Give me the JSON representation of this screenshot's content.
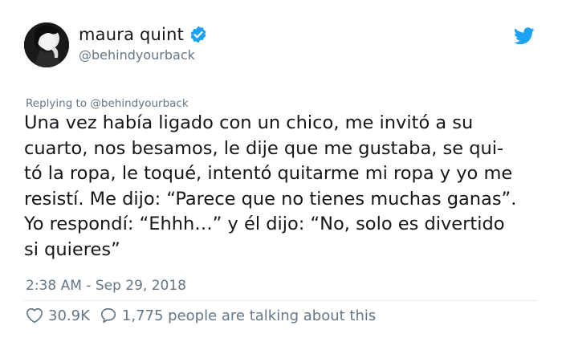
{
  "tweet": {
    "author": {
      "display_name": "maura quint",
      "handle": "@behindyourback",
      "verified": true,
      "avatar": "avatar-photo"
    },
    "reply_to": {
      "prefix": "Replying to",
      "mention": "@behindyourback"
    },
    "text": "Una vez había ligado con un chico, me invitó a su\ncuarto, nos besamos, le dije que me gustaba, se qui-\ntó la ropa, le toqué, intentó quitarme mi ropa y yo me\nresistí. Me dijo: “Parece que no tienes muchas ganas”.\nYo respondí: “Ehhh…” y él dijo: “No, solo es divertido\nsi quieres”",
    "timestamp": "2:38 AM - Sep 29, 2018",
    "likes": "30.9K",
    "talking": "1,775 people are talking about this",
    "icons": {
      "verified": "verified-badge-icon",
      "brand": "twitter-bird-icon",
      "like": "heart-icon",
      "reply": "speech-bubble-icon"
    },
    "colors": {
      "brand": "#1da1f2",
      "text": "#14171a",
      "secondary": "#657786"
    }
  }
}
